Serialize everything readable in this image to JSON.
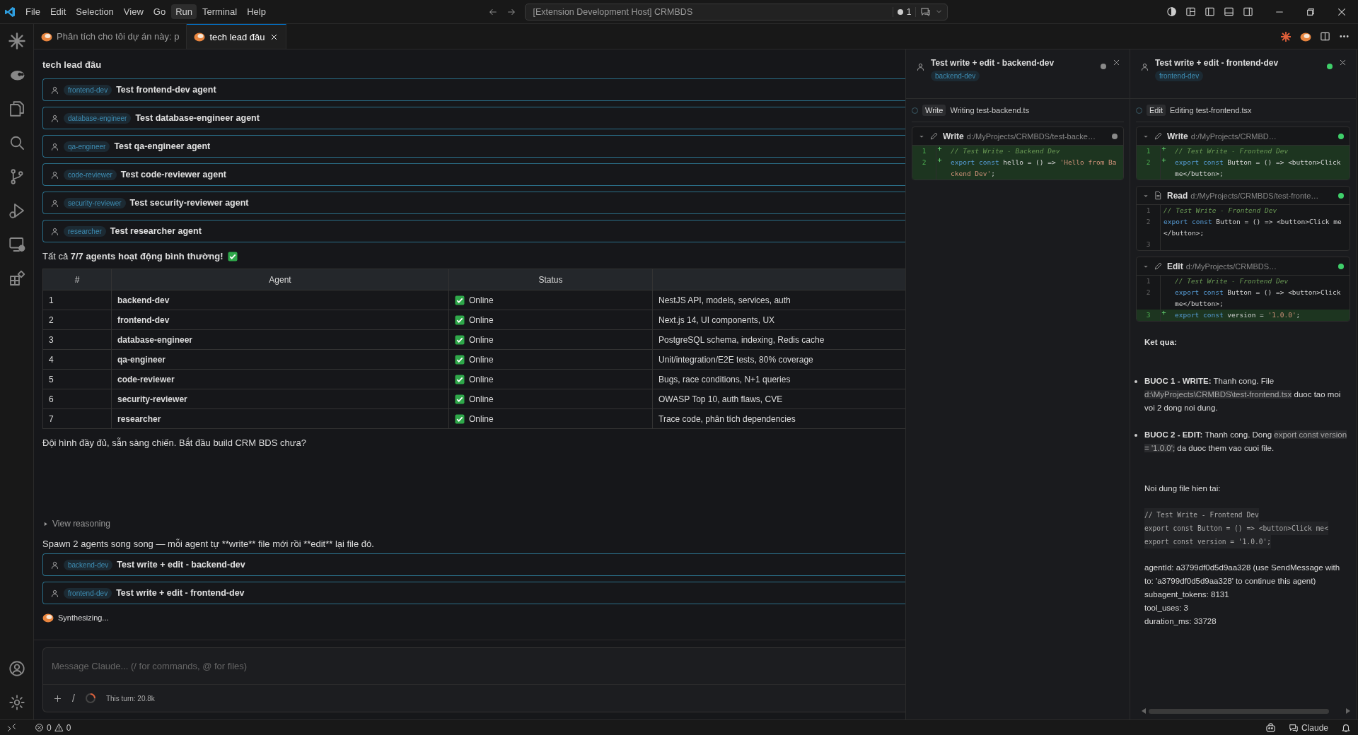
{
  "menu": [
    {
      "label": "File",
      "selected": false
    },
    {
      "label": "Edit",
      "selected": false
    },
    {
      "label": "Selection",
      "selected": false
    },
    {
      "label": "View",
      "selected": false
    },
    {
      "label": "Go",
      "selected": false
    },
    {
      "label": "Run",
      "selected": true
    },
    {
      "label": "Terminal",
      "selected": false
    },
    {
      "label": "Help",
      "selected": false
    }
  ],
  "command_center": {
    "title": "[Extension Development Host] CRMBDS",
    "badge": "1"
  },
  "tabs": [
    {
      "label": "Phân tích cho tôi dự án này: p",
      "selected": false
    },
    {
      "label": "tech lead đâu",
      "selected": true
    }
  ],
  "chat": {
    "title": "tech lead đâu",
    "agent_cards": [
      {
        "agent": "frontend-dev",
        "task": "Test frontend-dev agent"
      },
      {
        "agent": "database-engineer",
        "task": "Test database-engineer agent"
      },
      {
        "agent": "qa-engineer",
        "task": "Test qa-engineer agent"
      },
      {
        "agent": "code-reviewer",
        "task": "Test code-reviewer agent"
      },
      {
        "agent": "security-reviewer",
        "task": "Test security-reviewer agent"
      },
      {
        "agent": "researcher",
        "task": "Test researcher agent"
      }
    ],
    "summary": "Tất cả **7/7 agents hoạt động bình thường!**",
    "table": {
      "columns": [
        "#",
        "Agent",
        "Status"
      ],
      "rows": [
        [
          "1",
          "backend-dev",
          "Online",
          "NestJS API, models, services, auth"
        ],
        [
          "2",
          "frontend-dev",
          "Online",
          "Next.js 14, UI components, UX"
        ],
        [
          "3",
          "database-engineer",
          "Online",
          "PostgreSQL schema, indexing, Redis cache"
        ],
        [
          "4",
          "qa-engineer",
          "Online",
          "Unit/integration/E2E tests, 80% coverage"
        ],
        [
          "5",
          "code-reviewer",
          "Online",
          "Bugs, race conditions, N+1 queries"
        ],
        [
          "6",
          "security-reviewer",
          "Online",
          "OWASP Top 10, auth flaws, CVE"
        ],
        [
          "7",
          "researcher",
          "Online",
          "Trace code, phân tích dependencies"
        ]
      ]
    },
    "closing": "Đội hình đầy đủ, sẵn sàng chiến. Bắt đầu build CRM BDS chưa?",
    "reasoning": {
      "label": "View reasoning",
      "expanded": false
    },
    "spawn_text": "Spawn 2 agents song song — mỗi agent tự **write** file mới rồi **edit** lại file đó.",
    "spawn_cards": [
      {
        "agent": "backend-dev",
        "task": "Test write + edit - backend-dev"
      },
      {
        "agent": "frontend-dev",
        "task": "Test write + edit - frontend-dev"
      }
    ],
    "status": "Synthesizing..."
  },
  "input": {
    "placeholder": "Message Claude... (/ for commands, @ for files)",
    "command_key": "/",
    "turn": "This turn: 20.8k"
  },
  "panels": [
    {
      "title": "Test write + edit - backend-dev",
      "agent": "backend-dev",
      "color": "#8a8a8a",
      "activity": {
        "tool": "Write",
        "text": "Writing test-backend.ts"
      },
      "tools": [
        {
          "kind": "write",
          "name": "Write",
          "path": "d:/MyProjects/CRMBDS/test-backe…",
          "color": "#8a8a8a",
          "lines": [
            {
              "n": "1",
              "added": true,
              "segments": [
                {
                  "kind": "comment",
                  "text": "// Test Write - Backend Dev"
                }
              ]
            },
            {
              "n": "2",
              "added": true,
              "segments": [
                {
                  "kind": "keyword",
                  "text": "export const"
                },
                {
                  "kind": "plain",
                  "text": " hello = () => "
                },
                {
                  "kind": "string",
                  "text": "'Hello from Backend Dev'"
                },
                {
                  "kind": "plain",
                  "text": ";"
                }
              ]
            }
          ]
        }
      ]
    },
    {
      "title": "Test write + edit - frontend-dev",
      "agent": "frontend-dev",
      "color": "#3fcf6a",
      "activity": {
        "tool": "Edit",
        "text": "Editing test-frontend.tsx"
      },
      "tools": [
        {
          "kind": "write",
          "name": "Write",
          "path": "d:/MyProjects/CRMBD…",
          "color": "#3fcf6a",
          "lines": [
            {
              "n": "1",
              "added": true,
              "segments": [
                {
                  "kind": "comment",
                  "text": "// Test Write - Frontend Dev"
                }
              ]
            },
            {
              "n": "2",
              "added": true,
              "segments": [
                {
                  "kind": "keyword",
                  "text": "export const"
                },
                {
                  "kind": "plain",
                  "text": " Button = () => <button>Click me</button>;"
                }
              ]
            }
          ]
        },
        {
          "kind": "read",
          "name": "Read",
          "path": "d:/MyProjects/CRMBDS/test-fronte…",
          "color": "#3fcf6a",
          "lines": [
            {
              "n": "1",
              "added": false,
              "segments": [
                {
                  "kind": "comment",
                  "text": "// Test Write - Frontend Dev"
                }
              ]
            },
            {
              "n": "2",
              "added": false,
              "segments": [
                {
                  "kind": "keyword",
                  "text": "export const"
                },
                {
                  "kind": "plain",
                  "text": " Button = () => <button>Click me</button>;"
                }
              ]
            },
            {
              "n": "3",
              "added": false
            }
          ]
        },
        {
          "kind": "edit",
          "name": "Edit",
          "path": "d:/MyProjects/CRMBDS…",
          "color": "#3fcf6a",
          "lines": [
            {
              "n": "1",
              "added": false,
              "segments": [
                {
                  "kind": "comment",
                  "text": "// Test Write - Frontend Dev"
                }
              ]
            },
            {
              "n": "2",
              "added": false,
              "segments": [
                {
                  "kind": "keyword",
                  "text": "export const"
                },
                {
                  "kind": "plain",
                  "text": " Button = () => <button>Click me</button>;"
                }
              ]
            },
            {
              "n": "3",
              "added": true,
              "segments": [
                {
                  "kind": "keyword",
                  "text": "export const"
                },
                {
                  "kind": "plain",
                  "text": " version = "
                },
                {
                  "kind": "string",
                  "text": "'1.0.0'"
                },
                {
                  "kind": "plain",
                  "text": ";"
                }
              ]
            }
          ]
        }
      ],
      "result": {
        "heading": "Ket qua:",
        "bullets": [
          [
            {
              "kind": "text",
              "text": "**BUOC 1 - WRITE:** Thanh cong. File"
            },
            {
              "kind": "code",
              "text": "d:\\MyProjects\\CRMBDS\\test-frontend.tsx"
            },
            {
              "kind": "text",
              "text": "duoc tao moi voi 2 dong noi dung."
            }
          ],
          [
            {
              "kind": "text",
              "text": "**BUOC 2 - EDIT:** Thanh cong. Dong"
            },
            {
              "kind": "code",
              "text": "export const version = '1.0.0';"
            },
            {
              "kind": "text",
              "text": "da duoc them vao cuoi file."
            }
          ]
        ],
        "intro": "Noi dung file hien tai:",
        "code": [
          "// Test Write - Frontend Dev",
          "export const Button = () => <button>Click me<",
          "export const version = '1.0.0';"
        ],
        "meta": [
          "agentId: a3799df0d5d9aa328 (use SendMessage with to: 'a3799df0d5d9aa328' to continue this agent)",
          "subagent_tokens: 8131",
          "tool_uses: 3",
          "duration_ms: 33728"
        ]
      }
    }
  ],
  "status_bar": {
    "errors": "0",
    "warnings": "0",
    "chat": "Claude"
  }
}
